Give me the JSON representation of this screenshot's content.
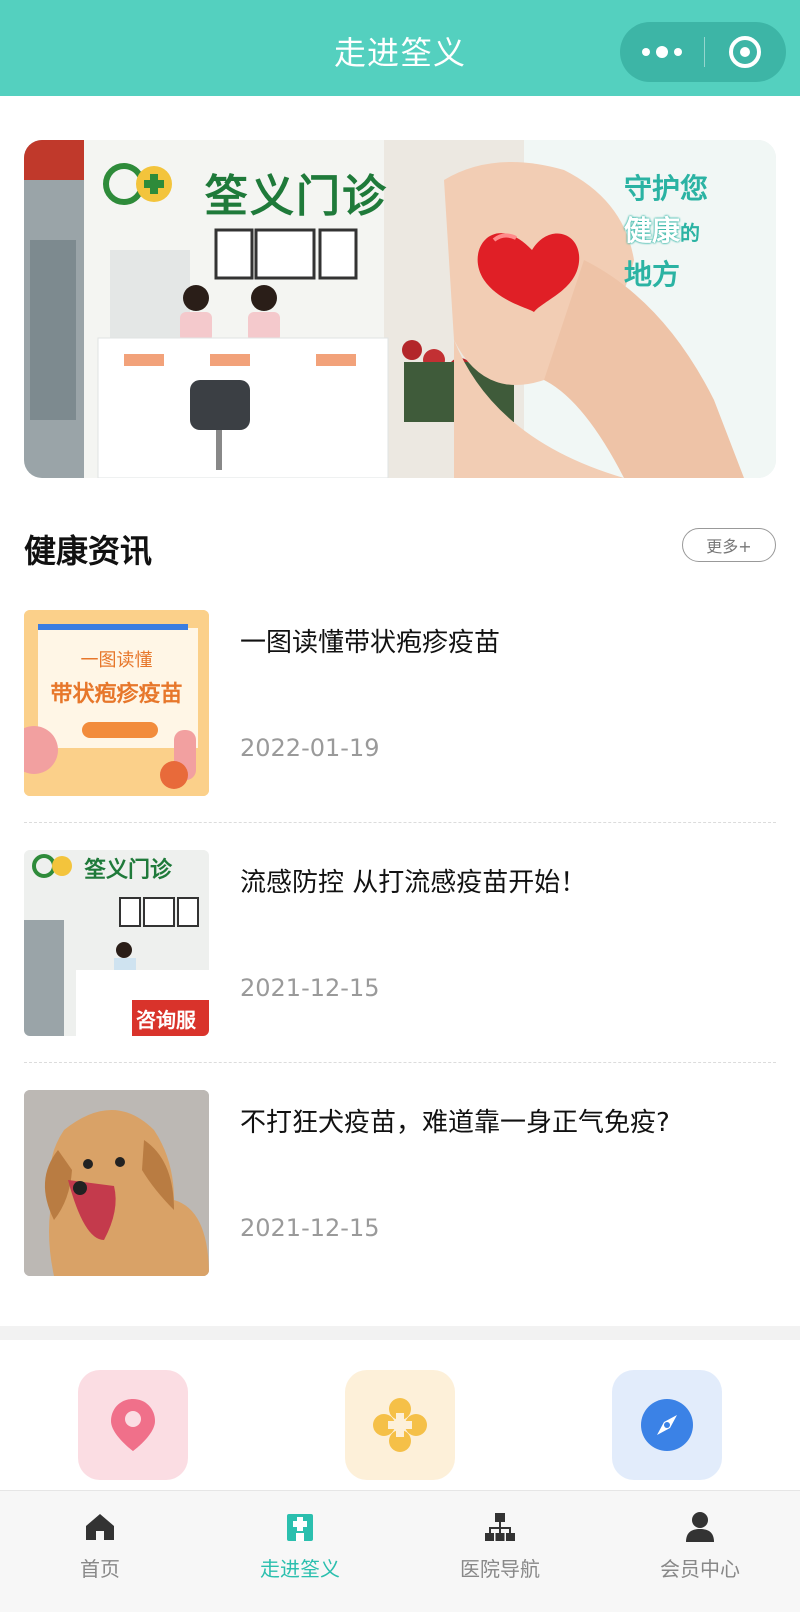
{
  "header": {
    "title": "走进筌义",
    "more_icon": "more-dots-icon",
    "close_icon": "target-close-icon"
  },
  "banner": {
    "logo_text": "筌义门诊",
    "slogan_line1": "守护您",
    "slogan_highlight": "健康",
    "slogan_suffix": "的",
    "slogan_line3": "地方"
  },
  "news": {
    "section_title": "健康资讯",
    "more_label": "更多+",
    "items": [
      {
        "title": "一图读懂带状疱疹疫苗",
        "date": "2022-01-19",
        "thumb_text_1": "一图读懂",
        "thumb_text_2": "带状疱疹疫苗"
      },
      {
        "title": "流感防控 从打流感疫苗开始！",
        "date": "2021-12-15",
        "thumb_text_1": "筌义门诊",
        "thumb_text_2": "咨询服"
      },
      {
        "title": "不打狂犬疫苗，难道靠一身正气免疫?",
        "date": "2021-12-15"
      }
    ]
  },
  "quick_tiles": [
    {
      "icon": "location-pin-icon",
      "bg": "#fbdde3",
      "color": "#f0708a"
    },
    {
      "icon": "clover-logo-icon",
      "bg": "#fdf0d9",
      "color": "#f5c048"
    },
    {
      "icon": "compass-icon",
      "bg": "#e2ecfb",
      "color": "#3b82e6"
    }
  ],
  "tabbar": {
    "items": [
      {
        "label": "首页",
        "icon": "home-icon"
      },
      {
        "label": "走进筌义",
        "icon": "hospital-icon"
      },
      {
        "label": "医院导航",
        "icon": "org-chart-icon"
      },
      {
        "label": "会员中心",
        "icon": "user-icon"
      }
    ],
    "active_index": 1,
    "active_color": "#2bbfae",
    "inactive_color": "#888888"
  },
  "colors": {
    "brand": "#54d0bf",
    "capsule": "#3db5a6"
  }
}
